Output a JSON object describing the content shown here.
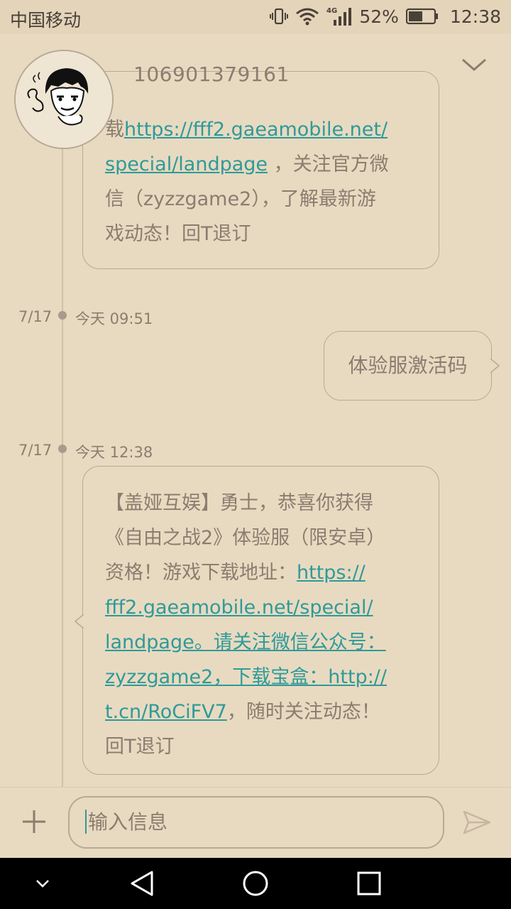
{
  "status_bar": {
    "carrier": "中国移动",
    "network": "4G",
    "battery": "52%",
    "time": "12:38"
  },
  "header": {
    "contact": "106901379161",
    "collapse_icon": "chevron-down-icon"
  },
  "messages": [
    {
      "direction": "incoming",
      "lines_before_link": "载",
      "link": "https://fff2.gaeamobile.net/special/landpage",
      "link_line1": "https://fff2.gaeamobile.net/",
      "link_line2": "special/landpage",
      "after_link_line2": " ，关注官方微",
      "line3": "信（zyzzgame2），了解最新游",
      "line4": "戏动态！回T退订"
    },
    {
      "direction": "outgoing",
      "date": "7/17",
      "time": "今天 09:51",
      "text": "体验服激活码"
    },
    {
      "direction": "incoming",
      "date": "7/17",
      "time": "今天 12:38",
      "line1": "【盖娅互娱】勇士，恭喜你获得",
      "line2": "《自由之战2》体验服（限安卓）",
      "line3_text": "资格！游戏下载地址：",
      "line3_link": "https://",
      "line4_link": "fff2.gaeamobile.net/special/",
      "line5_link": "landpage。请关注微信公众号：",
      "line6_link": "zyzzgame2，下载宝盒：http://",
      "line7_link": "t.cn/RoCiFV7",
      "line7_text": "，随时关注动态！",
      "line8": "回T退订"
    }
  ],
  "composer": {
    "placeholder": "输入信息"
  },
  "colors": {
    "background": "#e8dac0",
    "link": "#2e9a9a",
    "text": "#8a7d70",
    "border": "#b7a898"
  }
}
